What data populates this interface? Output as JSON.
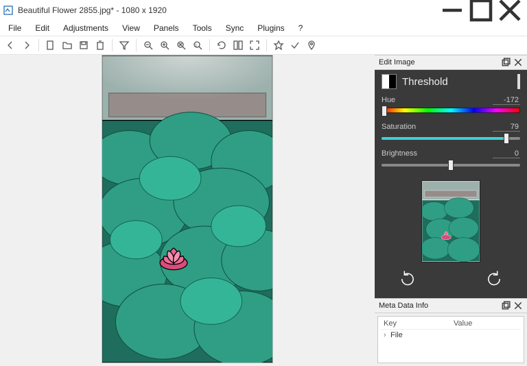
{
  "window": {
    "title": "Beautiful Flower 2855.jpg*  - 1080 x 1920"
  },
  "menu": {
    "items": [
      "File",
      "Edit",
      "Adjustments",
      "View",
      "Panels",
      "Tools",
      "Sync",
      "Plugins",
      "?"
    ]
  },
  "panels": {
    "edit": {
      "title": "Edit Image",
      "tool": "Threshold",
      "hue": {
        "label": "Hue",
        "value": "-172",
        "percent": 2
      },
      "saturation": {
        "label": "Saturation",
        "value": "79",
        "percent": 90
      },
      "brightness": {
        "label": "Brightness",
        "value": "0",
        "percent": 50
      }
    },
    "meta": {
      "title": "Meta Data Info",
      "columns": {
        "key": "Key",
        "value": "Value"
      },
      "rows": [
        {
          "key": "File",
          "value": ""
        }
      ]
    }
  }
}
